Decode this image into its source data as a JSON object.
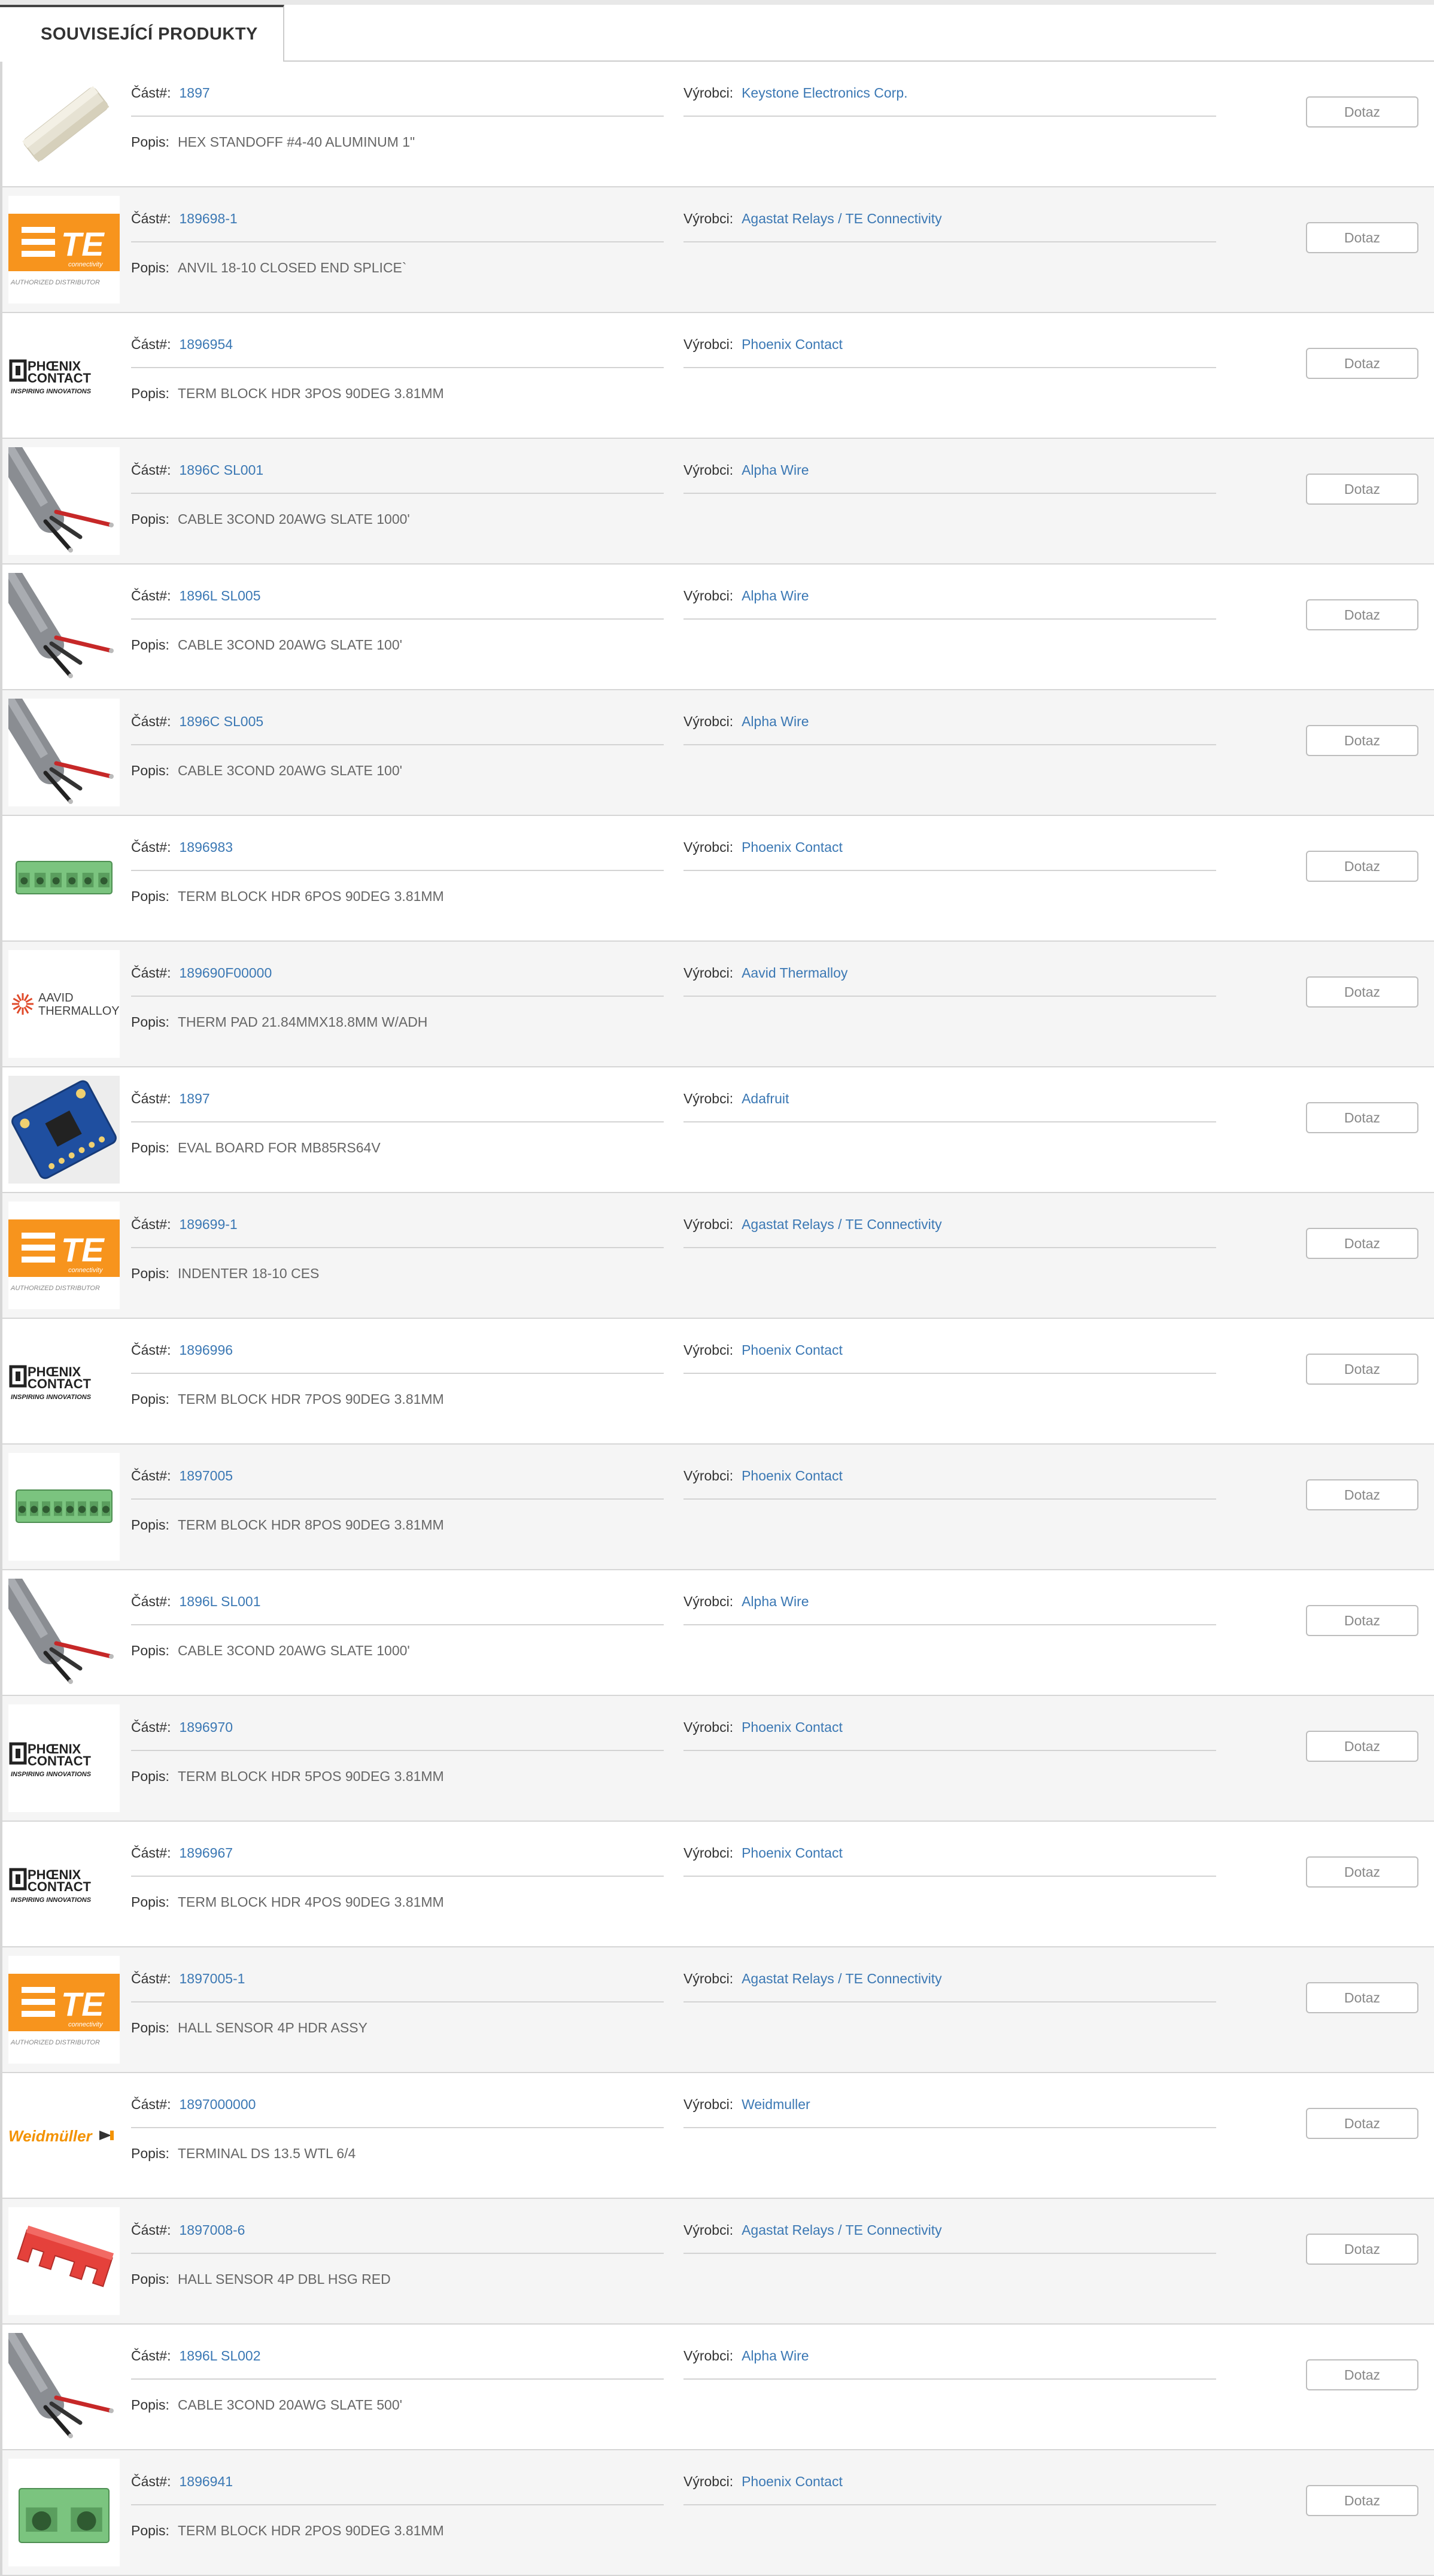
{
  "tab": {
    "label": "SOUVISEJÍCÍ PRODUKTY"
  },
  "labels": {
    "part": "Část#:",
    "manufacturer": "Výrobci:",
    "description": "Popis:",
    "button": "Dotaz"
  },
  "brand": {
    "te": "TE",
    "te_sub": "connectivity",
    "te_auth": "AUTHORIZED DISTRIBUTOR",
    "phoenix1": "PHŒNIX",
    "phoenix2": "CONTACT",
    "phoenix3": "INSPIRING INNOVATIONS",
    "aavid1": "AAVID",
    "aavid2": "THERMALLOY",
    "weidmuller": "Weidmüller"
  },
  "colors": {
    "link": "#3b78b4",
    "te_orange": "#f7941d",
    "weid_orange": "#f39200",
    "terminal_green": "#7bc47f"
  },
  "products": [
    {
      "part": "1897",
      "manufacturer": "Keystone Electronics Corp.",
      "description": "HEX STANDOFF #4-40 ALUMINUM 1\"",
      "image": "standoff"
    },
    {
      "part": "189698-1",
      "manufacturer": "Agastat Relays / TE Connectivity",
      "description": "ANVIL 18-10 CLOSED END SPLICE`",
      "image": "te-logo"
    },
    {
      "part": "1896954",
      "manufacturer": "Phoenix Contact",
      "description": "TERM BLOCK HDR 3POS 90DEG 3.81MM",
      "image": "phoenix-logo"
    },
    {
      "part": "1896C SL001",
      "manufacturer": "Alpha Wire",
      "description": "CABLE 3COND 20AWG SLATE 1000'",
      "image": "cable"
    },
    {
      "part": "1896L SL005",
      "manufacturer": "Alpha Wire",
      "description": "CABLE 3COND 20AWG SLATE 100'",
      "image": "cable"
    },
    {
      "part": "1896C SL005",
      "manufacturer": "Alpha Wire",
      "description": "CABLE 3COND 20AWG SLATE 100'",
      "image": "cable"
    },
    {
      "part": "1896983",
      "manufacturer": "Phoenix Contact",
      "description": "TERM BLOCK HDR 6POS 90DEG 3.81MM",
      "image": "terminal-6"
    },
    {
      "part": "189690F00000",
      "manufacturer": "Aavid Thermalloy",
      "description": "THERM PAD 21.84MMX18.8MM W/ADH",
      "image": "aavid-logo"
    },
    {
      "part": "1897",
      "manufacturer": "Adafruit",
      "description": "EVAL BOARD FOR MB85RS64V",
      "image": "board"
    },
    {
      "part": "189699-1",
      "manufacturer": "Agastat Relays / TE Connectivity",
      "description": "INDENTER 18-10 CES",
      "image": "te-logo"
    },
    {
      "part": "1896996",
      "manufacturer": "Phoenix Contact",
      "description": "TERM BLOCK HDR 7POS 90DEG 3.81MM",
      "image": "phoenix-logo"
    },
    {
      "part": "1897005",
      "manufacturer": "Phoenix Contact",
      "description": "TERM BLOCK HDR 8POS 90DEG 3.81MM",
      "image": "terminal-8"
    },
    {
      "part": "1896L SL001",
      "manufacturer": "Alpha Wire",
      "description": "CABLE 3COND 20AWG SLATE 1000'",
      "image": "cable"
    },
    {
      "part": "1896970",
      "manufacturer": "Phoenix Contact",
      "description": "TERM BLOCK HDR 5POS 90DEG 3.81MM",
      "image": "phoenix-logo"
    },
    {
      "part": "1896967",
      "manufacturer": "Phoenix Contact",
      "description": "TERM BLOCK HDR 4POS 90DEG 3.81MM",
      "image": "phoenix-logo"
    },
    {
      "part": "1897005-1",
      "manufacturer": "Agastat Relays / TE Connectivity",
      "description": "HALL SENSOR 4P HDR ASSY",
      "image": "te-logo"
    },
    {
      "part": "1897000000",
      "manufacturer": "Weidmuller",
      "description": "TERMINAL DS 13.5 WTL 6/4",
      "image": "weidmuller-logo"
    },
    {
      "part": "1897008-6",
      "manufacturer": "Agastat Relays / TE Connectivity",
      "description": "HALL SENSOR 4P DBL HSG RED",
      "image": "red-housing"
    },
    {
      "part": "1896L SL002",
      "manufacturer": "Alpha Wire",
      "description": "CABLE 3COND 20AWG SLATE 500'",
      "image": "cable"
    },
    {
      "part": "1896941",
      "manufacturer": "Phoenix Contact",
      "description": "TERM BLOCK HDR 2POS 90DEG 3.81MM",
      "image": "terminal-2"
    }
  ]
}
